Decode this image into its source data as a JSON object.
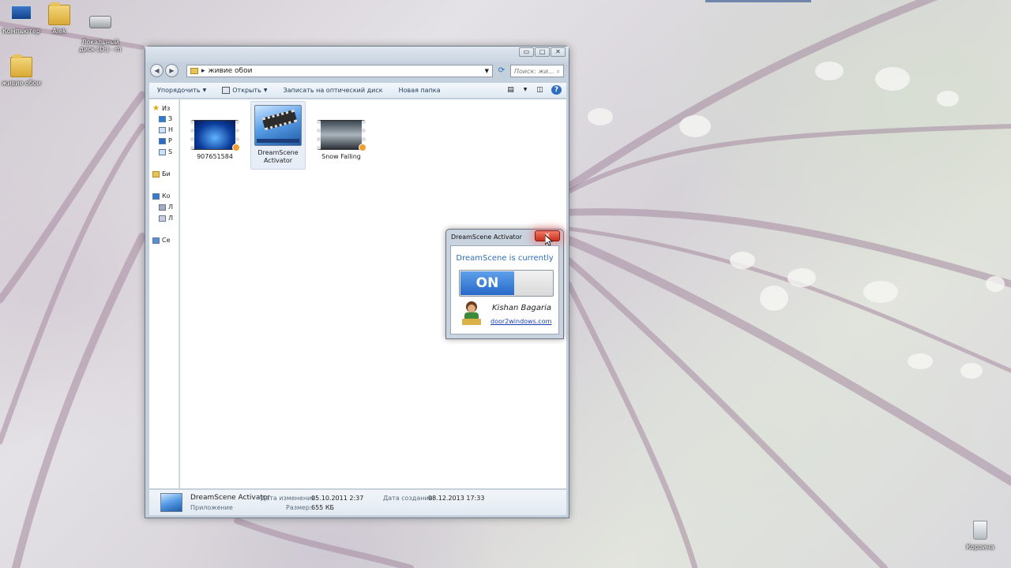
{
  "desktop": {
    "icons": [
      {
        "label": "Компьютер"
      },
      {
        "label": "Alek"
      },
      {
        "label": "Локальный диск (D:) - m"
      },
      {
        "label": "живие обои"
      }
    ],
    "recycle_bin": {
      "label": "Корзина"
    }
  },
  "explorer": {
    "caption_buttons": {
      "minimize": "▭",
      "maximize": "□",
      "close": "✕"
    },
    "nav_back": "◀",
    "nav_forward": "▶",
    "address": {
      "separator": "▸",
      "path": "живие обои"
    },
    "search": {
      "placeholder": "Поиск: жи...",
      "icon": "search-icon"
    },
    "toolbar": {
      "organize": "Упорядочить",
      "open": "Открыть",
      "burn": "Записать на оптический диск",
      "new_folder": "Новая папка"
    },
    "nav_pane": {
      "items": [
        {
          "label": "Из"
        },
        {
          "label": "З"
        },
        {
          "label": "Н"
        },
        {
          "label": "Р"
        },
        {
          "label": "S"
        },
        {
          "label": "Би"
        },
        {
          "label": "Ко"
        },
        {
          "label": "Л"
        },
        {
          "label": "Л"
        },
        {
          "label": "Се"
        }
      ]
    },
    "files": [
      {
        "name": "907651584"
      },
      {
        "name": "DreamScene Activator"
      },
      {
        "name": "Snow Falling"
      }
    ],
    "status": {
      "name": "DreamScene Activator",
      "type": "Приложение",
      "modified_label": "Дата изменения:",
      "modified_value": "05.10.2011 2:37",
      "size_label": "Размер:",
      "size_value": "655 КБ",
      "created_label": "Дата создания:",
      "created_value": "08.12.2013 17:33"
    }
  },
  "popup": {
    "title": "DreamScene Activator",
    "close": "✕",
    "status_text": "DreamScene is currently",
    "toggle_state": "ON",
    "author": "Kishan Bagaria",
    "link": "door2windows.com"
  },
  "colors": {
    "accent": "#2f6fb3",
    "toggle_on": "#2769c8",
    "close_red": "#c8321e"
  }
}
